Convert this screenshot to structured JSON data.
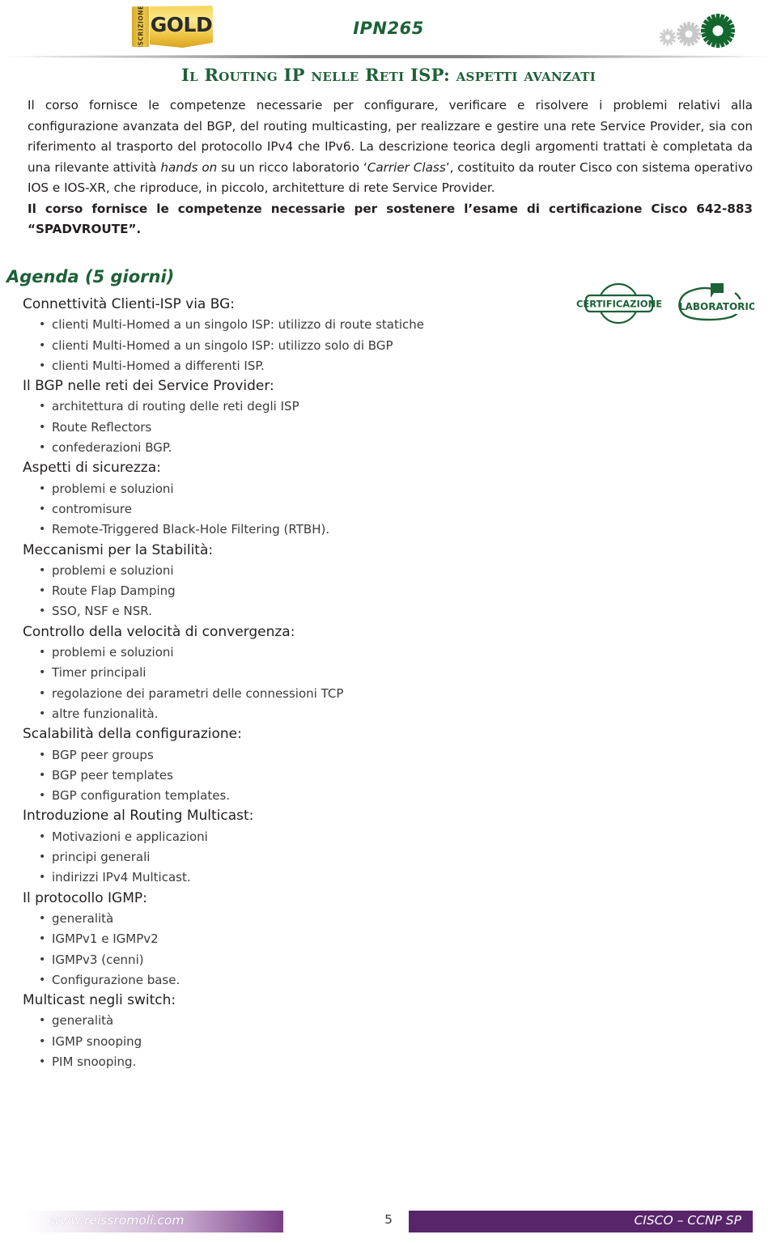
{
  "header": {
    "logo": {
      "vertical_text": "ISCRIZIONE",
      "main_text": "GOLD"
    },
    "course_code": "IPN265",
    "gears_icon": "gears-icon"
  },
  "title": "Il Routing IP nelle Reti ISP: aspetti avanzati",
  "intro": {
    "part1": "Il corso fornisce le competenze necessarie per configurare, verificare e risolvere i problemi relativi alla configurazione avanzata del BGP, del routing multicasting, per realizzare e gestire una rete Service Provider, sia con riferimento al trasporto del protocollo IPv4 che IPv6. La descrizione teorica degli argomenti trattati è completata da una rilevante attività ",
    "italic1": "hands on",
    "part2": " su un ricco laboratorio ‘",
    "italic2": "Carrier Class",
    "part3": "’, costituito da router Cisco con sistema operativo IOS e IOS-XR, che riproduce, in piccolo, architetture di rete Service Provider.",
    "bold_line": "Il corso fornisce le competenze necessarie per sostenere l’esame di certificazione Cisco 642-883 “SPADVROUTE”."
  },
  "agenda": {
    "heading": "Agenda (5 giorni)",
    "badges": [
      {
        "label": "CERTIFICAZIONE",
        "icon": "certification-badge-icon"
      },
      {
        "label": "LABORATORIO",
        "icon": "laboratory-badge-icon"
      }
    ],
    "sections": [
      {
        "title": "Connettività Clienti-ISP via BG:",
        "items": [
          "clienti Multi-Homed a un singolo ISP: utilizzo di route statiche",
          "clienti Multi-Homed a un singolo ISP: utilizzo solo di BGP",
          "clienti Multi-Homed a differenti ISP."
        ]
      },
      {
        "title": "Il BGP nelle reti dei Service Provider:",
        "items": [
          "architettura di routing delle reti degli ISP",
          "Route Reflectors",
          "confederazioni BGP."
        ]
      },
      {
        "title": "Aspetti di sicurezza:",
        "items": [
          "problemi e soluzioni",
          "contromisure",
          "Remote-Triggered Black-Hole Filtering (RTBH)."
        ]
      },
      {
        "title": "Meccanismi per la Stabilità:",
        "items": [
          "problemi e soluzioni",
          "Route Flap Damping",
          "SSO, NSF e NSR."
        ]
      },
      {
        "title": "Controllo della velocità di convergenza:",
        "items": [
          "problemi e soluzioni",
          "Timer principali",
          "regolazione dei parametri delle connessioni TCP",
          "altre funzionalità."
        ]
      },
      {
        "title": "Scalabilità della configurazione:",
        "items": [
          "BGP peer groups",
          "BGP peer templates",
          "BGP configuration templates."
        ]
      },
      {
        "title": "Introduzione al Routing Multicast:",
        "items": [
          "Motivazioni e applicazioni",
          "principi generali",
          "indirizzi IPv4 Multicast."
        ]
      },
      {
        "title": "Il protocollo IGMP:",
        "items": [
          "generalità",
          "IGMPv1 e IGMPv2",
          "IGMPv3 (cenni)",
          "Configurazione base."
        ]
      },
      {
        "title": "Multicast negli switch:",
        "items": [
          "generalità",
          "IGMP snooping",
          "PIM snooping."
        ]
      }
    ]
  },
  "footer": {
    "website": "www.reissromoli.com",
    "page_number": "5",
    "course_family": "CISCO – CCNP SP"
  },
  "colors": {
    "green": "#1d6137",
    "purple": "#58256a",
    "gold": "#f0c531",
    "text": "#231f20"
  }
}
